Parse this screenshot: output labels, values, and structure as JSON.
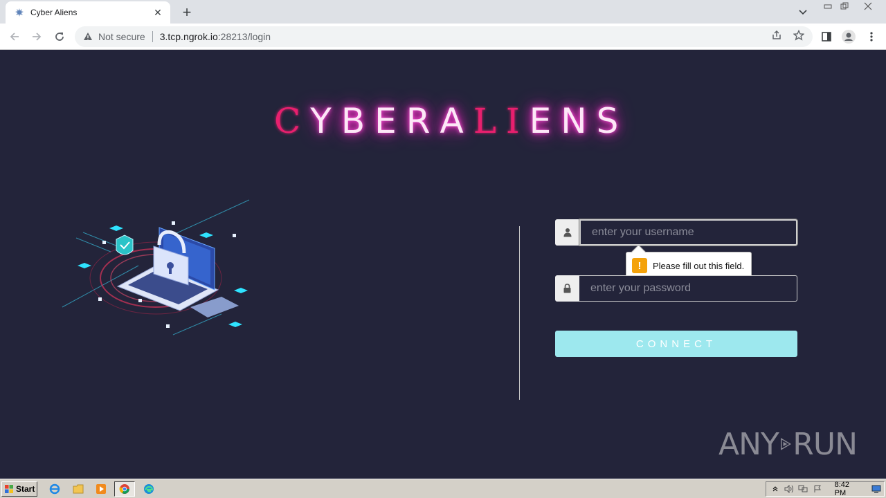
{
  "browser": {
    "tab": {
      "title": "Cyber Aliens",
      "close_glyph": "✕"
    },
    "new_tab_glyph": "+",
    "address": {
      "security_label": "Not secure",
      "url_host": "3.tcp.ngrok.io",
      "url_rest": ":28213/login"
    }
  },
  "page": {
    "brand": {
      "letters": [
        {
          "char": "C",
          "style": "pink"
        },
        {
          "char": "Y",
          "style": "glow"
        },
        {
          "char": "B",
          "style": "glow"
        },
        {
          "char": "E",
          "style": "glow"
        },
        {
          "char": "R",
          "style": "glow"
        },
        {
          "char": "A",
          "style": "glow"
        },
        {
          "char": "L",
          "style": "pink"
        },
        {
          "char": "I",
          "style": "pink"
        },
        {
          "char": "E",
          "style": "glow"
        },
        {
          "char": "N",
          "style": "glow"
        },
        {
          "char": "S",
          "style": "glow"
        }
      ]
    },
    "login": {
      "username_placeholder": "enter your username",
      "password_placeholder": "enter your password",
      "connect_label": "CONNECT",
      "validation_message": "Please fill out this field.",
      "validation_glyph": "!"
    },
    "watermark": {
      "left": "ANY",
      "right": "RUN"
    }
  },
  "taskbar": {
    "start_label": "Start",
    "clock": "8:42 PM"
  },
  "colors": {
    "page_bg": "#23243a",
    "brand_pink": "#e8206e",
    "glow": "#ff2ec8",
    "connect_bg": "#9de8ee",
    "tooltip_icon": "#f4a20b"
  }
}
